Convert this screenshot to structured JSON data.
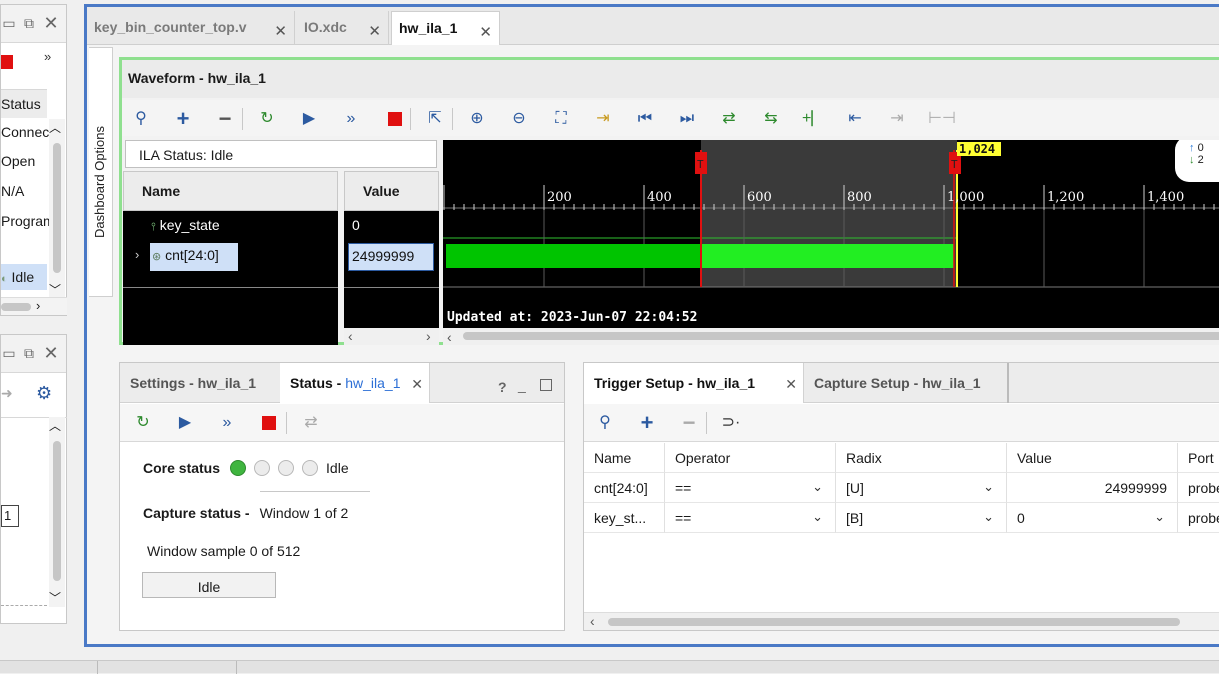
{
  "left_panel_top": {
    "items": [
      "Status",
      "Connect",
      "Open",
      "N/A",
      "Program",
      "Idle"
    ]
  },
  "left_panel_bottom": {
    "input_value": "1"
  },
  "editor": {
    "tabs": [
      {
        "label": "key_bin_counter_top.v"
      },
      {
        "label": "IO.xdc"
      },
      {
        "label": "hw_ila_1"
      }
    ],
    "sidebar_label": "Dashboard Options"
  },
  "waveform": {
    "title": "Waveform - hw_ila_1",
    "ila_status": "ILA Status:  Idle",
    "col_name": "Name",
    "col_value": "Value",
    "signals": [
      {
        "name": "key_state",
        "value": "0",
        "icon": "bit-icon"
      },
      {
        "name": "cnt[24:0]",
        "value": "24999999",
        "icon": "bus-icon"
      }
    ],
    "cursor_label": "1,024",
    "trigger_marker": "T",
    "ticks": [
      "200",
      "400",
      "600",
      "800",
      "1,000",
      "1,200",
      "1,400"
    ],
    "updated": "Updated at: 2023-Jun-07 22:04:52",
    "legend": [
      "0",
      "2"
    ]
  },
  "status_panel": {
    "tabs": [
      {
        "label": "Settings - hw_ila_1"
      },
      {
        "label_prefix": "Status - ",
        "label_link": "hw_ila_1"
      }
    ],
    "core_status_label": "Core status",
    "core_status_value": "Idle",
    "capture_status_label": "Capture status -",
    "capture_status_value": "Window 1 of 2",
    "window_sample": "Window sample 0 of 512",
    "button_label": "Idle",
    "help": "?"
  },
  "trigger_panel": {
    "tabs": [
      {
        "label": "Trigger Setup - hw_ila_1"
      },
      {
        "label": "Capture Setup - hw_ila_1"
      }
    ],
    "columns": [
      "Name",
      "Operator",
      "Radix",
      "Value",
      "Port"
    ],
    "rows": [
      {
        "name": "cnt[24:0]",
        "operator": "==",
        "radix": "[U]",
        "value": "24999999",
        "port": "probe"
      },
      {
        "name": "key_st...",
        "operator": "==",
        "radix": "[B]",
        "value": "0",
        "port": "probe"
      }
    ]
  },
  "colors": {
    "accent_blue": "#4a79c6",
    "wave_border": "#8fe08f",
    "waveform_green": "#1fe61f",
    "cursor_yellow": "#ffff00",
    "trigger_red": "#e01010"
  }
}
